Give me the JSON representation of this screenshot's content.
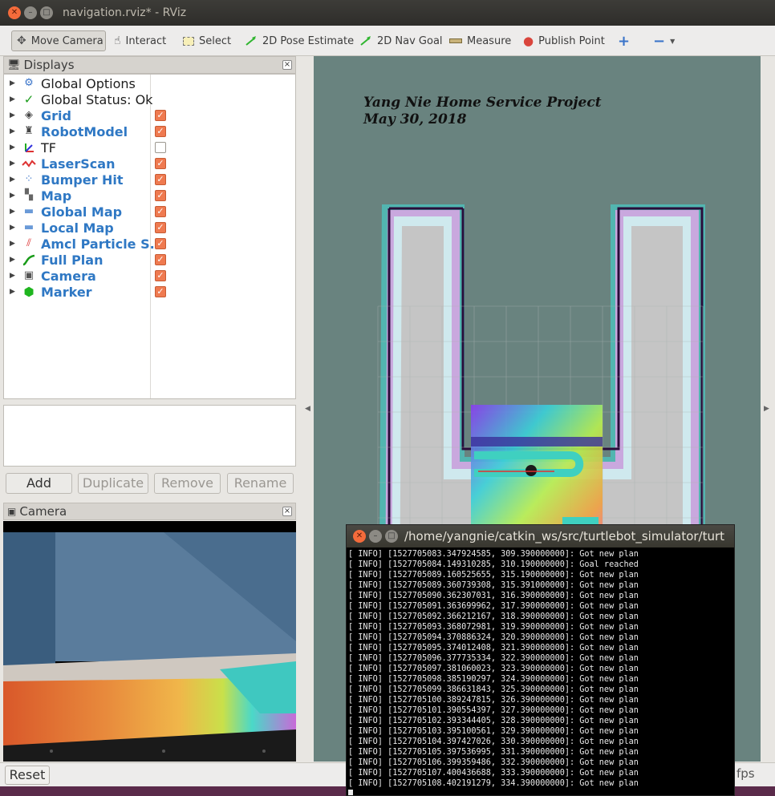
{
  "window": {
    "title": "navigation.rviz* - RViz"
  },
  "toolbar": {
    "tools": [
      {
        "label": "Move Camera",
        "icon": "move-camera-icon"
      },
      {
        "label": "Interact",
        "icon": "hand-icon"
      },
      {
        "label": "Select",
        "icon": "select-icon"
      },
      {
        "label": "2D Pose Estimate",
        "icon": "pose-arrow-icon"
      },
      {
        "label": "2D Nav Goal",
        "icon": "nav-goal-arrow-icon"
      },
      {
        "label": "Measure",
        "icon": "ruler-icon"
      },
      {
        "label": "Publish Point",
        "icon": "map-pin-icon"
      }
    ],
    "add_tool_icon": "plus-icon",
    "remove_tool_icon": "minus-icon",
    "active_tool": "Move Camera",
    "checked_color": "#ef7a50"
  },
  "displays": {
    "header": "Displays",
    "items": [
      {
        "label": "Global Options",
        "icon": "gear-icon",
        "checked": null
      },
      {
        "label": "Global Status: Ok",
        "icon": "checkmark-icon",
        "checked": null
      },
      {
        "label": "Grid",
        "icon": "grid-icon",
        "checked": true
      },
      {
        "label": "RobotModel",
        "icon": "robot-icon",
        "checked": true
      },
      {
        "label": "TF",
        "icon": "tf-axes-icon",
        "checked": false
      },
      {
        "label": "LaserScan",
        "icon": "laser-scan-icon",
        "checked": true
      },
      {
        "label": "Bumper Hit",
        "icon": "point-cloud-icon",
        "checked": true
      },
      {
        "label": "Map",
        "icon": "map-icon",
        "checked": true
      },
      {
        "label": "Global Map",
        "icon": "folder-icon",
        "checked": true
      },
      {
        "label": "Local Map",
        "icon": "folder-icon",
        "checked": true
      },
      {
        "label": "Amcl Particle S...",
        "icon": "particle-arrows-icon",
        "checked": true
      },
      {
        "label": "Full Plan",
        "icon": "path-icon",
        "checked": true
      },
      {
        "label": "Camera",
        "icon": "camera-icon",
        "checked": true
      },
      {
        "label": "Marker",
        "icon": "cube-icon",
        "checked": true
      }
    ],
    "buttons": {
      "add": "Add",
      "duplicate": "Duplicate",
      "remove": "Remove",
      "rename": "Rename"
    }
  },
  "camera_panel": {
    "header": "Camera"
  },
  "viewport": {
    "caption_line1": "Yang Nie Home Service Project",
    "caption_line2": "May 30, 2018"
  },
  "statusbar": {
    "reset": "Reset",
    "fps": "fps"
  },
  "terminal": {
    "title": "/home/yangnie/catkin_ws/src/turtlebot_simulator/turt",
    "lines": [
      "[ INFO] [1527705083.347924585, 309.390000000]: Got new plan",
      "[ INFO] [1527705084.149310285, 310.190000000]: Goal reached",
      "[ INFO] [1527705089.160525655, 315.190000000]: Got new plan",
      "[ INFO] [1527705089.360739308, 315.391000000]: Got new plan",
      "[ INFO] [1527705090.362307031, 316.390000000]: Got new plan",
      "[ INFO] [1527705091.363699962, 317.390000000]: Got new plan",
      "[ INFO] [1527705092.366212167, 318.390000000]: Got new plan",
      "[ INFO] [1527705093.368072981, 319.390000000]: Got new plan",
      "[ INFO] [1527705094.370886324, 320.390000000]: Got new plan",
      "[ INFO] [1527705095.374012408, 321.390000000]: Got new plan",
      "[ INFO] [1527705096.377735334, 322.390000000]: Got new plan",
      "[ INFO] [1527705097.381060023, 323.390000000]: Got new plan",
      "[ INFO] [1527705098.385190297, 324.390000000]: Got new plan",
      "[ INFO] [1527705099.386631843, 325.390000000]: Got new plan",
      "[ INFO] [1527705100.389247815, 326.390000000]: Got new plan",
      "[ INFO] [1527705101.390554397, 327.390000000]: Got new plan",
      "[ INFO] [1527705102.393344405, 328.390000000]: Got new plan",
      "[ INFO] [1527705103.395100561, 329.390000000]: Got new plan",
      "[ INFO] [1527705104.397427026, 330.390000000]: Got new plan",
      "[ INFO] [1527705105.397536995, 331.390000000]: Got new plan",
      "[ INFO] [1527705106.399359486, 332.390000000]: Got new plan",
      "[ INFO] [1527705107.400436688, 333.390000000]: Got new plan",
      "[ INFO] [1527705108.402191279, 334.390000000]: Got new plan"
    ]
  }
}
